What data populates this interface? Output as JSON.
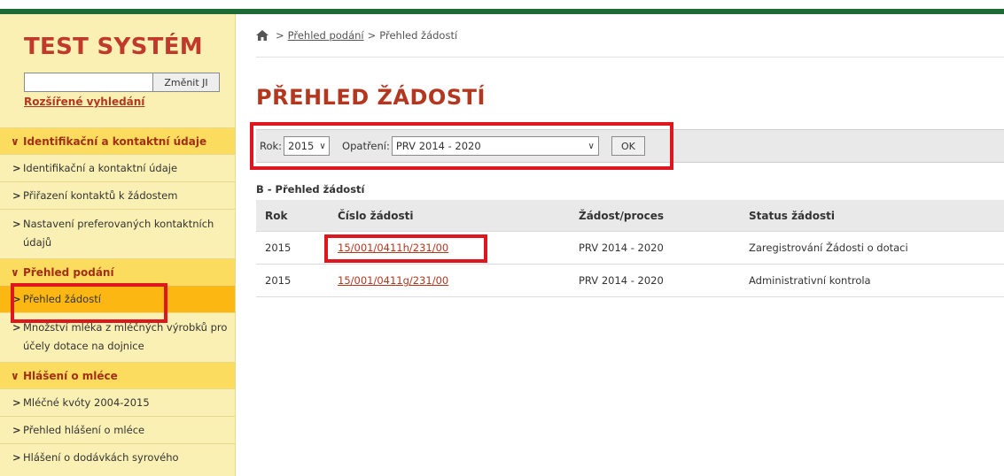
{
  "sidebar": {
    "brand": "TEST SYSTÉM",
    "search": {
      "value": "",
      "button_label": "Změnit JI"
    },
    "advanced_search": "Rozšířené vyhledání",
    "menu": [
      {
        "type": "section",
        "label": "Identifikační a kontaktní údaje"
      },
      {
        "type": "link",
        "label": "Identifikační a kontaktní údaje"
      },
      {
        "type": "link",
        "label": "Přiřazení kontaktů k žádostem"
      },
      {
        "type": "link",
        "label": "Nastavení preferovaných kontaktních údajů"
      },
      {
        "type": "section",
        "label": "Přehled podání"
      },
      {
        "type": "link",
        "label": "Přehled žádostí",
        "active": true
      },
      {
        "type": "link",
        "label": "Množství mléka z mléčných výrobků pro účely dotace na dojnice"
      },
      {
        "type": "section",
        "label": "Hlášení o mléce"
      },
      {
        "type": "link",
        "label": "Mléčné kvóty 2004-2015"
      },
      {
        "type": "link",
        "label": "Přehled hlášení o mléce"
      },
      {
        "type": "link",
        "label": "Hlášení o dodávkách syrového"
      }
    ]
  },
  "breadcrumb": {
    "sep1": ">",
    "parent": "Přehled podání",
    "sep2": ">",
    "current": "Přehled žádostí"
  },
  "page_title": "PŘEHLED ŽÁDOSTÍ",
  "filter": {
    "year_label": "Rok:",
    "year_value": "2015",
    "measure_label": "Opatření:",
    "measure_value": "PRV 2014 - 2020",
    "ok_label": "OK"
  },
  "table": {
    "caption": "B - Přehled žádostí",
    "headers": [
      "Rok",
      "Číslo žádosti",
      "Žádost/proces",
      "Status žádosti"
    ],
    "rows": [
      [
        "2015",
        "15/001/0411h/231/00",
        "PRV 2014 - 2020",
        "Zaregistrování Žádosti o dotaci"
      ],
      [
        "2015",
        "15/001/0411g/231/00",
        "PRV 2014 - 2020",
        "Administrativní kontrola"
      ]
    ]
  },
  "colors": {
    "brand_red": "#b3371f",
    "sidebar_bg": "#fbf0b4",
    "section_bg": "#fbdc5e",
    "active_bg": "#fcb712",
    "highlight": "#e0161f",
    "top_bar": "#1e6b35"
  }
}
